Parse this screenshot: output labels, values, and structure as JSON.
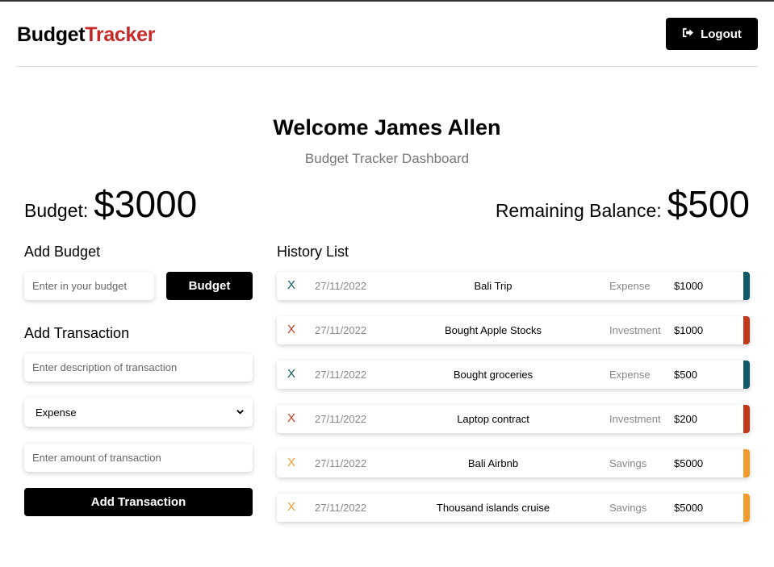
{
  "header": {
    "logo_part1": "Budget",
    "logo_part2": "Tracker",
    "logout_label": "Logout"
  },
  "welcome": "Welcome James Allen",
  "subtitle": "Budget Tracker Dashboard",
  "budget": {
    "label": "Budget:",
    "value": "$3000"
  },
  "remaining": {
    "label": "Remaining Balance:",
    "value": "$500"
  },
  "add_budget": {
    "title": "Add Budget",
    "placeholder": "Enter in your budget",
    "button": "Budget"
  },
  "add_transaction": {
    "title": "Add Transaction",
    "description_placeholder": "Enter description of transaction",
    "type_selected": "Expense",
    "amount_placeholder": "Enter amount of transaction",
    "button": "Add Transaction"
  },
  "history": {
    "title": "History List",
    "items": [
      {
        "delete": "X",
        "date": "27/11/2022",
        "description": "Bali Trip",
        "type": "Expense",
        "amount": "$1000",
        "color": "#0e5a6a"
      },
      {
        "delete": "X",
        "date": "27/11/2022",
        "description": "Bought Apple Stocks",
        "type": "Investment",
        "amount": "$1000",
        "color": "#c0391b"
      },
      {
        "delete": "X",
        "date": "27/11/2022",
        "description": "Bought groceries",
        "type": "Expense",
        "amount": "$500",
        "color": "#0e5a6a"
      },
      {
        "delete": "X",
        "date": "27/11/2022",
        "description": "Laptop contract",
        "type": "Investment",
        "amount": "$200",
        "color": "#c0391b"
      },
      {
        "delete": "X",
        "date": "27/11/2022",
        "description": "Bali Airbnb",
        "type": "Savings",
        "amount": "$5000",
        "color": "#f29a2e"
      },
      {
        "delete": "X",
        "date": "27/11/2022",
        "description": "Thousand islands cruise",
        "type": "Savings",
        "amount": "$5000",
        "color": "#f29a2e"
      }
    ]
  }
}
